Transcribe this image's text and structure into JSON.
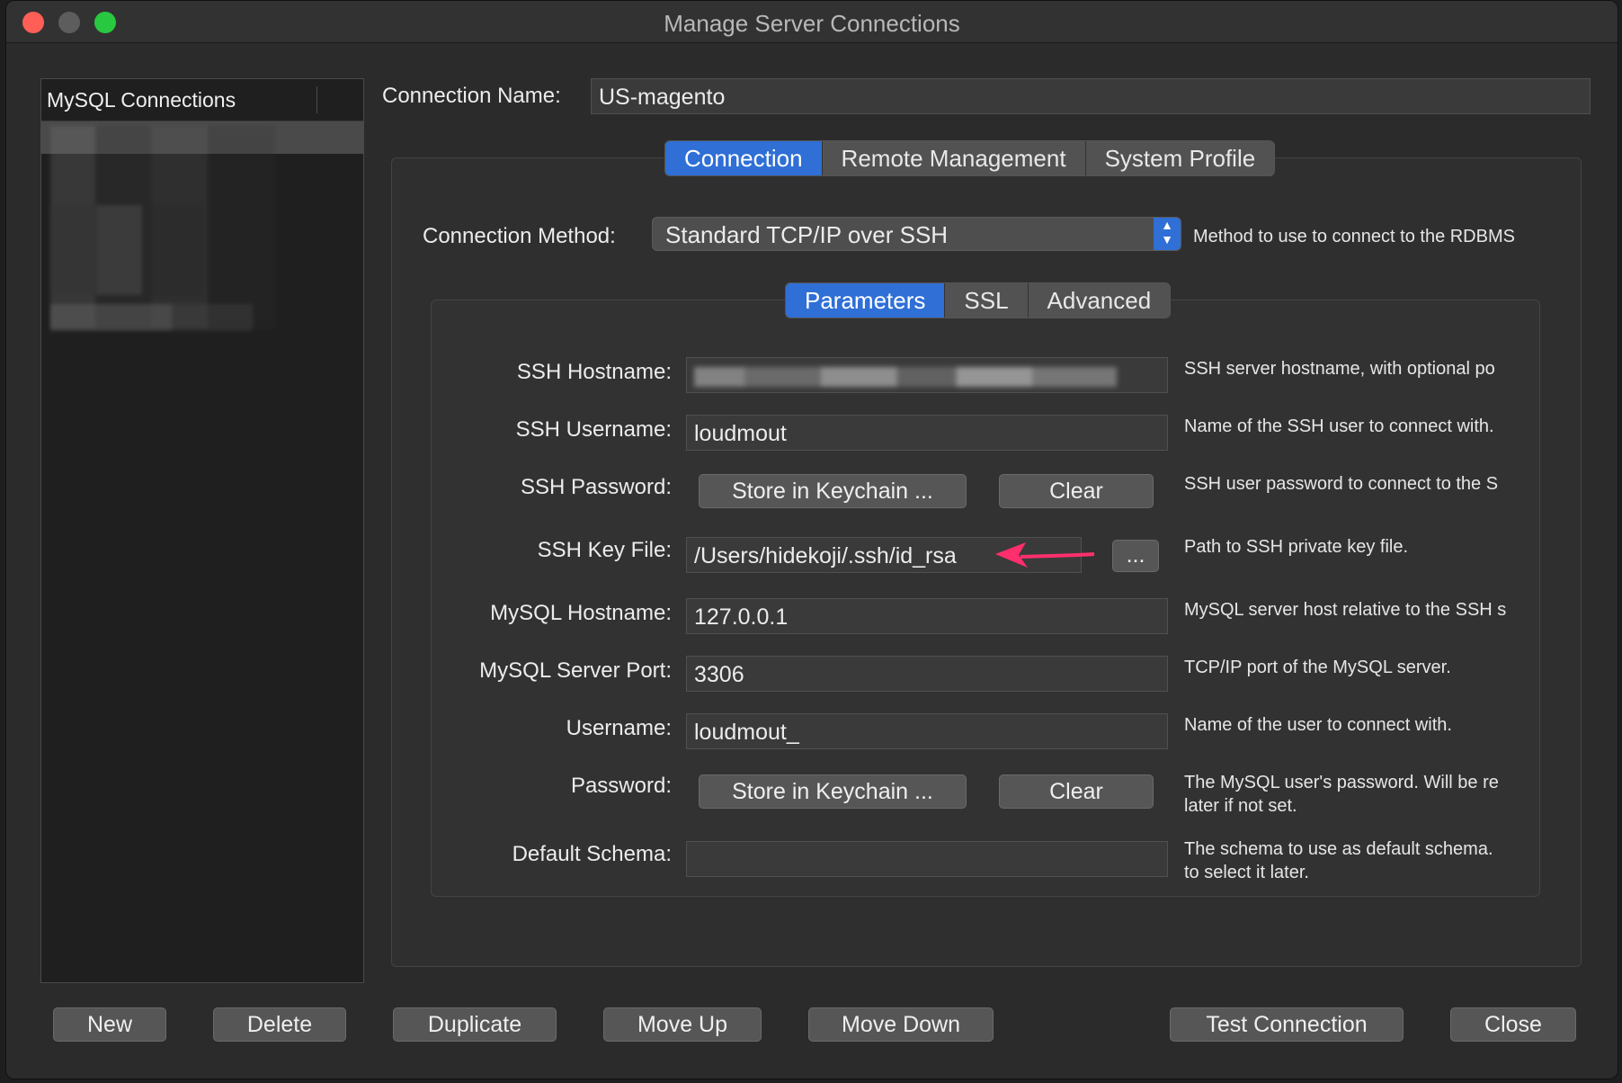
{
  "window": {
    "title": "Manage Server Connections"
  },
  "sidebar": {
    "header": "MySQL Connections"
  },
  "connection_name": {
    "label": "Connection Name:",
    "value": "US-magento"
  },
  "main_tabs": [
    {
      "label": "Connection",
      "active": true
    },
    {
      "label": "Remote Management",
      "active": false
    },
    {
      "label": "System Profile",
      "active": false
    }
  ],
  "method": {
    "label": "Connection Method:",
    "value": "Standard TCP/IP over SSH",
    "hint": "Method to use to connect to the RDBMS"
  },
  "sub_tabs": [
    {
      "label": "Parameters",
      "active": true
    },
    {
      "label": "SSL",
      "active": false
    },
    {
      "label": "Advanced",
      "active": false
    }
  ],
  "params": {
    "ssh_hostname": {
      "label": "SSH Hostname:",
      "value": "",
      "hint": "SSH server hostname, with  optional po"
    },
    "ssh_username": {
      "label": "SSH Username:",
      "value": "loudmout",
      "hint": "Name of the SSH user to connect with."
    },
    "ssh_password": {
      "label": "SSH Password:",
      "store_label": "Store in Keychain ...",
      "clear_label": "Clear",
      "hint": "SSH user password to connect to the S"
    },
    "ssh_keyfile": {
      "label": "SSH Key File:",
      "value": "/Users/hidekoji/.ssh/id_rsa",
      "browse_label": "...",
      "hint": "Path to SSH private key file."
    },
    "mysql_hostname": {
      "label": "MySQL Hostname:",
      "value": "127.0.0.1",
      "hint": "MySQL server host relative to the SSH s"
    },
    "mysql_port": {
      "label": "MySQL Server Port:",
      "value": "3306",
      "hint": "TCP/IP port of the MySQL server."
    },
    "username": {
      "label": "Username:",
      "value": "loudmout_",
      "hint": "Name of the user to connect with."
    },
    "password": {
      "label": "Password:",
      "store_label": "Store in Keychain ...",
      "clear_label": "Clear",
      "hint_line1": "The MySQL user's password. Will be re",
      "hint_line2": "later if not set."
    },
    "default_schema": {
      "label": "Default Schema:",
      "value": "",
      "hint_line1": "The schema to use as default schema.",
      "hint_line2": "to select it later."
    }
  },
  "footer": {
    "new": "New",
    "delete": "Delete",
    "duplicate": "Duplicate",
    "move_up": "Move Up",
    "move_down": "Move Down",
    "test_connection": "Test Connection",
    "close": "Close"
  },
  "colors": {
    "accent": "#2f6fd6",
    "annotation_arrow": "#ff2f6d"
  }
}
